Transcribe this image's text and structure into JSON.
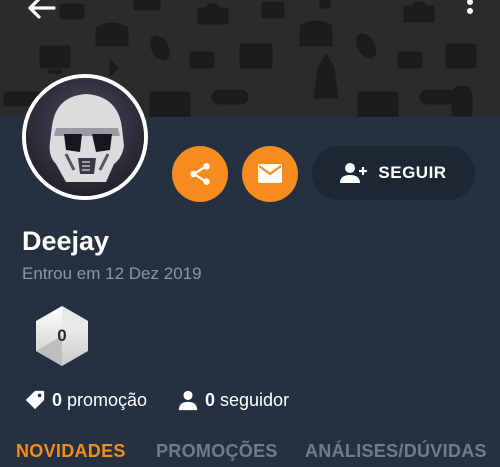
{
  "colors": {
    "accent": "#f68b1e",
    "background": "#253141",
    "banner": "#2b2b2b",
    "follow_button": "#1c2733",
    "muted_text": "#8b95a3"
  },
  "header": {
    "back_icon": "arrow-left-icon",
    "menu_icon": "more-vertical-icon"
  },
  "profile": {
    "username": "Deejay",
    "joined": "Entrou em 12 Dez 2019",
    "badge_count": "0"
  },
  "actions": {
    "share_icon": "share-icon",
    "message_icon": "mail-icon",
    "follow_label": "SEGUIR",
    "follow_icon": "person-add-icon"
  },
  "stats": {
    "promotions": {
      "count": "0",
      "label": "promoção",
      "icon": "tag-icon"
    },
    "followers": {
      "count": "0",
      "label": "seguidor",
      "icon": "person-icon"
    }
  },
  "tabs": [
    {
      "label": "NOVIDADES",
      "active": true
    },
    {
      "label": "PROMOÇÕES",
      "active": false
    },
    {
      "label": "ANÁLISES/DÚVIDAS",
      "active": false
    }
  ]
}
